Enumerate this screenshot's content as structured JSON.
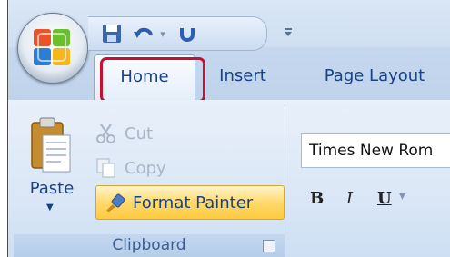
{
  "quick_access": {
    "save_icon": "save-icon",
    "undo_icon": "undo-icon",
    "undo_dropdown_icon": "chevron-down-icon",
    "redo_icon": "redo-icon",
    "customize_icon": "customize-qat-icon"
  },
  "tabs": [
    {
      "label": "Home",
      "selected": true
    },
    {
      "label": "Insert"
    },
    {
      "label": "Page Layout"
    }
  ],
  "clipboard": {
    "paste_label": "Paste",
    "cut_label": "Cut",
    "copy_label": "Copy",
    "format_painter_label": "Format Painter",
    "group_label": "Clipboard"
  },
  "font_group": {
    "font_name": "Times New Rom",
    "bold_label": "B",
    "italic_label": "I",
    "underline_label": "U"
  },
  "colors": {
    "highlight_box": "#c8102e",
    "tab_text": "#15428b",
    "format_painter_bg": "#ffd96b"
  }
}
